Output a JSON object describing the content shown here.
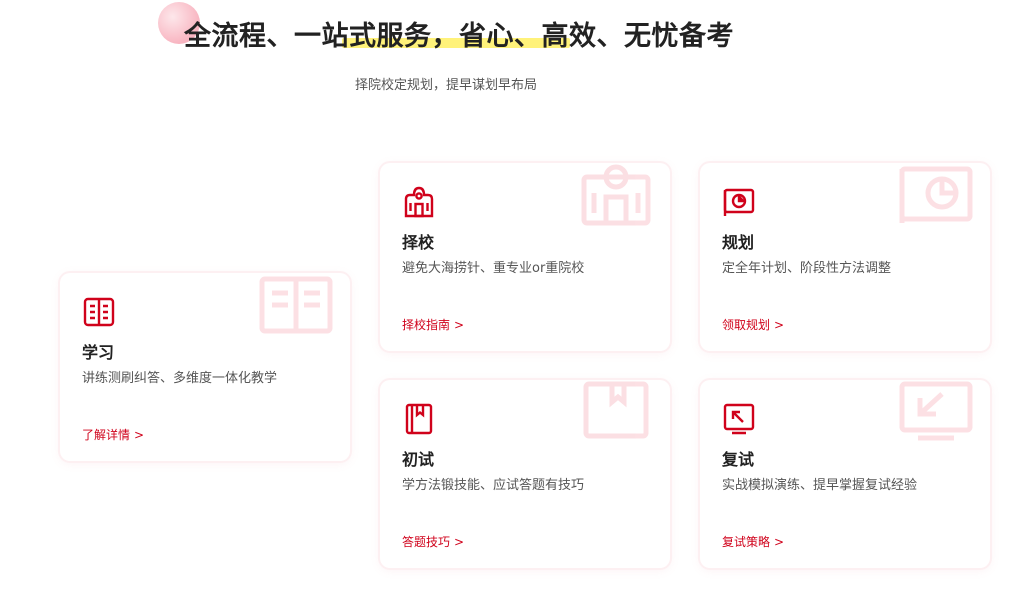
{
  "hero": {
    "title": "全流程、一站式服务，省心、高效、无忧备考",
    "subtitle": "择院校定规划，提早谋划早布局"
  },
  "cards": {
    "study": {
      "title": "学习",
      "desc": "讲练测刷纠答、多维度一体化教学",
      "link": "了解详情",
      "icon": "book-icon"
    },
    "school": {
      "title": "择校",
      "desc": "避免大海捞针、重专业or重院校",
      "link": "择校指南",
      "icon": "school-building-icon"
    },
    "plan": {
      "title": "规划",
      "desc": "定全年计划、阶段性方法调整",
      "link": "领取规划",
      "icon": "pie-chart-icon"
    },
    "initial": {
      "title": "初试",
      "desc": "学方法锻技能、应试答题有技巧",
      "link": "答题技巧",
      "icon": "bookmark-book-icon"
    },
    "retest": {
      "title": "复试",
      "desc": "实战模拟演练、提早掌握复试经验",
      "link": "复试策略",
      "icon": "screen-arrow-icon"
    }
  },
  "link_arrow": ">",
  "colors": {
    "accent": "#d0021b",
    "highlight": "#fff27a"
  }
}
